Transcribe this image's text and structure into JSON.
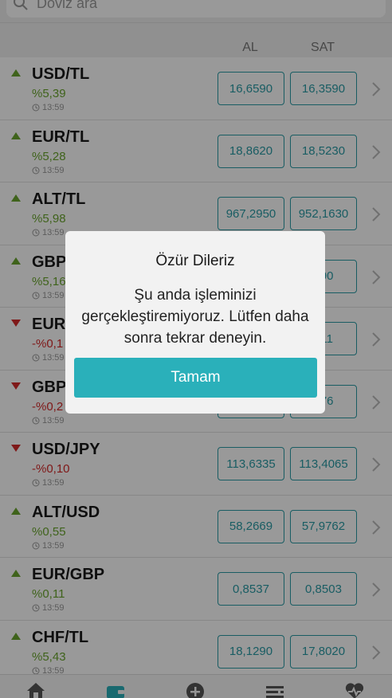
{
  "search": {
    "placeholder": "Döviz ara"
  },
  "header": {
    "al": "AL",
    "sat": "SAT"
  },
  "rows": [
    {
      "pair": "USD/TL",
      "trend": "up",
      "change": "%5,39",
      "time": "13:59",
      "buy": "16,6590",
      "sell": "16,3590"
    },
    {
      "pair": "EUR/TL",
      "trend": "up",
      "change": "%5,28",
      "time": "13:59",
      "buy": "18,8620",
      "sell": "18,5230"
    },
    {
      "pair": "ALT/TL",
      "trend": "up",
      "change": "%5,98",
      "time": "13:59",
      "buy": "967,2950",
      "sell": "952,1630"
    },
    {
      "pair": "GBP",
      "trend": "up",
      "change": "%5,16",
      "time": "13:59",
      "buy": "",
      "sell": "390"
    },
    {
      "pair": "EUR/",
      "trend": "down",
      "change": "-%0,1",
      "time": "13:59",
      "buy": "",
      "sell": "811"
    },
    {
      "pair": "GBP",
      "trend": "down",
      "change": "-%0,2",
      "time": "13:59",
      "buy": "",
      "sell": "276"
    },
    {
      "pair": "USD/JPY",
      "trend": "down",
      "change": "-%0,10",
      "time": "13:59",
      "buy": "113,6335",
      "sell": "113,4065"
    },
    {
      "pair": "ALT/USD",
      "trend": "up",
      "change": "%0,55",
      "time": "13:59",
      "buy": "58,2669",
      "sell": "57,9762"
    },
    {
      "pair": "EUR/GBP",
      "trend": "up",
      "change": "%0,11",
      "time": "13:59",
      "buy": "0,8537",
      "sell": "0,8503"
    },
    {
      "pair": "CHF/TL",
      "trend": "up",
      "change": "%5,43",
      "time": "13:59",
      "buy": "18,1290",
      "sell": "17,8020"
    }
  ],
  "tabs": [
    {
      "icon": "home-icon"
    },
    {
      "icon": "wallet-icon",
      "active": true
    },
    {
      "icon": "plus-circle-icon"
    },
    {
      "icon": "list-icon"
    },
    {
      "icon": "heart-pulse-icon"
    }
  ],
  "dialog": {
    "title": "Özür Dileriz",
    "message": "Şu anda işleminizi gerçekleştiremiyoruz. Lütfen daha sonra tekrar deneyin.",
    "button": "Tamam"
  },
  "colors": {
    "accent": "#2ab0ba",
    "up": "#6aa52e",
    "down": "#d42a2a",
    "price_border": "#2a9ba5"
  }
}
